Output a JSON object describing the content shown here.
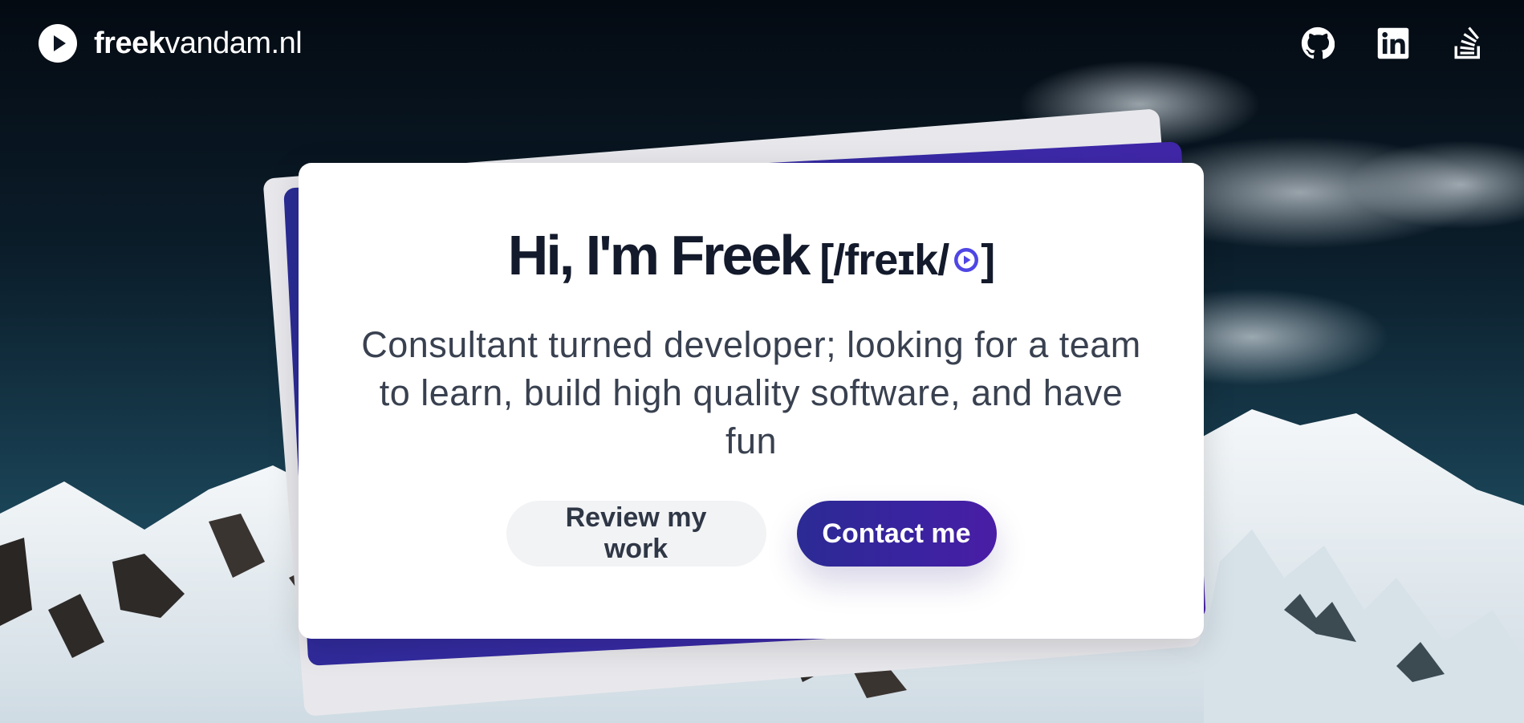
{
  "header": {
    "brand_bold": "freek",
    "brand_light": "vandam.nl",
    "socials": [
      {
        "name": "github-icon"
      },
      {
        "name": "linkedin-icon"
      },
      {
        "name": "stackoverflow-icon"
      }
    ]
  },
  "hero": {
    "title": "Hi, I'm Freek",
    "pronunciation_open": "[/freɪk/",
    "pronunciation_close": "]",
    "tagline": "Consultant turned developer; looking for a team to learn, build high quality software, and have fun",
    "review_button": "Review my work",
    "contact_button": "Contact me"
  },
  "colors": {
    "accent": "#2b2a94",
    "accent_end": "#4a1da6",
    "title": "#131a2b",
    "text": "#394150",
    "play_icon": "#4f46e5"
  }
}
